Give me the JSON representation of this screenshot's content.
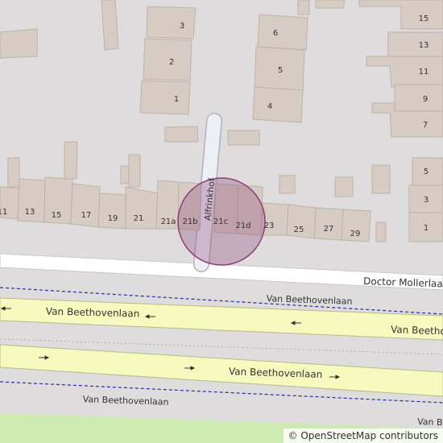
{
  "map": {
    "streets": {
      "alfrinkhof": "Alfrinkhof",
      "doctor_mollerlaan": "Doctor Mollerlaan",
      "van_beethovenlaan": "Van Beethovenlaan",
      "van_beethovenlaan_partial": "Van Be"
    },
    "house_numbers": {
      "top_left": [
        "3",
        "2",
        "1"
      ],
      "top_middle": [
        "6",
        "5",
        "4"
      ],
      "top_right": [
        "15",
        "13",
        "11",
        "9",
        "7"
      ],
      "row": [
        "11",
        "13",
        "15",
        "17",
        "19",
        "21",
        "21a",
        "21b",
        "21c",
        "21d",
        "23",
        "25",
        "27",
        "29"
      ],
      "right_side": [
        "5",
        "3",
        "1"
      ]
    },
    "attribution": "© OpenStreetMap contributors"
  }
}
